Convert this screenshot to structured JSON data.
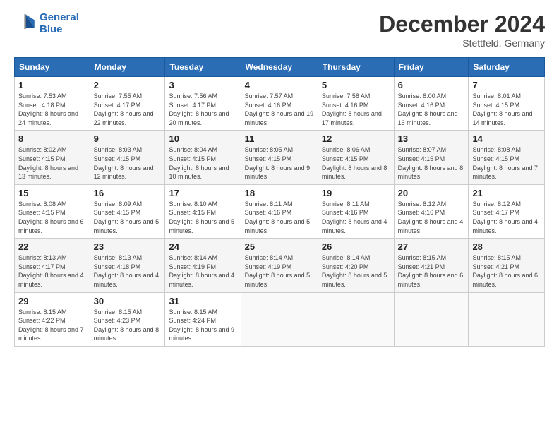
{
  "header": {
    "logo_line1": "General",
    "logo_line2": "Blue",
    "month": "December 2024",
    "location": "Stettfeld, Germany"
  },
  "days_of_week": [
    "Sunday",
    "Monday",
    "Tuesday",
    "Wednesday",
    "Thursday",
    "Friday",
    "Saturday"
  ],
  "weeks": [
    [
      {
        "num": "1",
        "sunrise": "7:53 AM",
        "sunset": "4:18 PM",
        "daylight": "8 hours and 24 minutes."
      },
      {
        "num": "2",
        "sunrise": "7:55 AM",
        "sunset": "4:17 PM",
        "daylight": "8 hours and 22 minutes."
      },
      {
        "num": "3",
        "sunrise": "7:56 AM",
        "sunset": "4:17 PM",
        "daylight": "8 hours and 20 minutes."
      },
      {
        "num": "4",
        "sunrise": "7:57 AM",
        "sunset": "4:16 PM",
        "daylight": "8 hours and 19 minutes."
      },
      {
        "num": "5",
        "sunrise": "7:58 AM",
        "sunset": "4:16 PM",
        "daylight": "8 hours and 17 minutes."
      },
      {
        "num": "6",
        "sunrise": "8:00 AM",
        "sunset": "4:16 PM",
        "daylight": "8 hours and 16 minutes."
      },
      {
        "num": "7",
        "sunrise": "8:01 AM",
        "sunset": "4:15 PM",
        "daylight": "8 hours and 14 minutes."
      }
    ],
    [
      {
        "num": "8",
        "sunrise": "8:02 AM",
        "sunset": "4:15 PM",
        "daylight": "8 hours and 13 minutes."
      },
      {
        "num": "9",
        "sunrise": "8:03 AM",
        "sunset": "4:15 PM",
        "daylight": "8 hours and 12 minutes."
      },
      {
        "num": "10",
        "sunrise": "8:04 AM",
        "sunset": "4:15 PM",
        "daylight": "8 hours and 10 minutes."
      },
      {
        "num": "11",
        "sunrise": "8:05 AM",
        "sunset": "4:15 PM",
        "daylight": "8 hours and 9 minutes."
      },
      {
        "num": "12",
        "sunrise": "8:06 AM",
        "sunset": "4:15 PM",
        "daylight": "8 hours and 8 minutes."
      },
      {
        "num": "13",
        "sunrise": "8:07 AM",
        "sunset": "4:15 PM",
        "daylight": "8 hours and 8 minutes."
      },
      {
        "num": "14",
        "sunrise": "8:08 AM",
        "sunset": "4:15 PM",
        "daylight": "8 hours and 7 minutes."
      }
    ],
    [
      {
        "num": "15",
        "sunrise": "8:08 AM",
        "sunset": "4:15 PM",
        "daylight": "8 hours and 6 minutes."
      },
      {
        "num": "16",
        "sunrise": "8:09 AM",
        "sunset": "4:15 PM",
        "daylight": "8 hours and 5 minutes."
      },
      {
        "num": "17",
        "sunrise": "8:10 AM",
        "sunset": "4:15 PM",
        "daylight": "8 hours and 5 minutes."
      },
      {
        "num": "18",
        "sunrise": "8:11 AM",
        "sunset": "4:16 PM",
        "daylight": "8 hours and 5 minutes."
      },
      {
        "num": "19",
        "sunrise": "8:11 AM",
        "sunset": "4:16 PM",
        "daylight": "8 hours and 4 minutes."
      },
      {
        "num": "20",
        "sunrise": "8:12 AM",
        "sunset": "4:16 PM",
        "daylight": "8 hours and 4 minutes."
      },
      {
        "num": "21",
        "sunrise": "8:12 AM",
        "sunset": "4:17 PM",
        "daylight": "8 hours and 4 minutes."
      }
    ],
    [
      {
        "num": "22",
        "sunrise": "8:13 AM",
        "sunset": "4:17 PM",
        "daylight": "8 hours and 4 minutes."
      },
      {
        "num": "23",
        "sunrise": "8:13 AM",
        "sunset": "4:18 PM",
        "daylight": "8 hours and 4 minutes."
      },
      {
        "num": "24",
        "sunrise": "8:14 AM",
        "sunset": "4:19 PM",
        "daylight": "8 hours and 4 minutes."
      },
      {
        "num": "25",
        "sunrise": "8:14 AM",
        "sunset": "4:19 PM",
        "daylight": "8 hours and 5 minutes."
      },
      {
        "num": "26",
        "sunrise": "8:14 AM",
        "sunset": "4:20 PM",
        "daylight": "8 hours and 5 minutes."
      },
      {
        "num": "27",
        "sunrise": "8:15 AM",
        "sunset": "4:21 PM",
        "daylight": "8 hours and 6 minutes."
      },
      {
        "num": "28",
        "sunrise": "8:15 AM",
        "sunset": "4:21 PM",
        "daylight": "8 hours and 6 minutes."
      }
    ],
    [
      {
        "num": "29",
        "sunrise": "8:15 AM",
        "sunset": "4:22 PM",
        "daylight": "8 hours and 7 minutes."
      },
      {
        "num": "30",
        "sunrise": "8:15 AM",
        "sunset": "4:23 PM",
        "daylight": "8 hours and 8 minutes."
      },
      {
        "num": "31",
        "sunrise": "8:15 AM",
        "sunset": "4:24 PM",
        "daylight": "8 hours and 9 minutes."
      },
      null,
      null,
      null,
      null
    ]
  ],
  "labels": {
    "sunrise": "Sunrise:",
    "sunset": "Sunset:",
    "daylight": "Daylight:"
  }
}
